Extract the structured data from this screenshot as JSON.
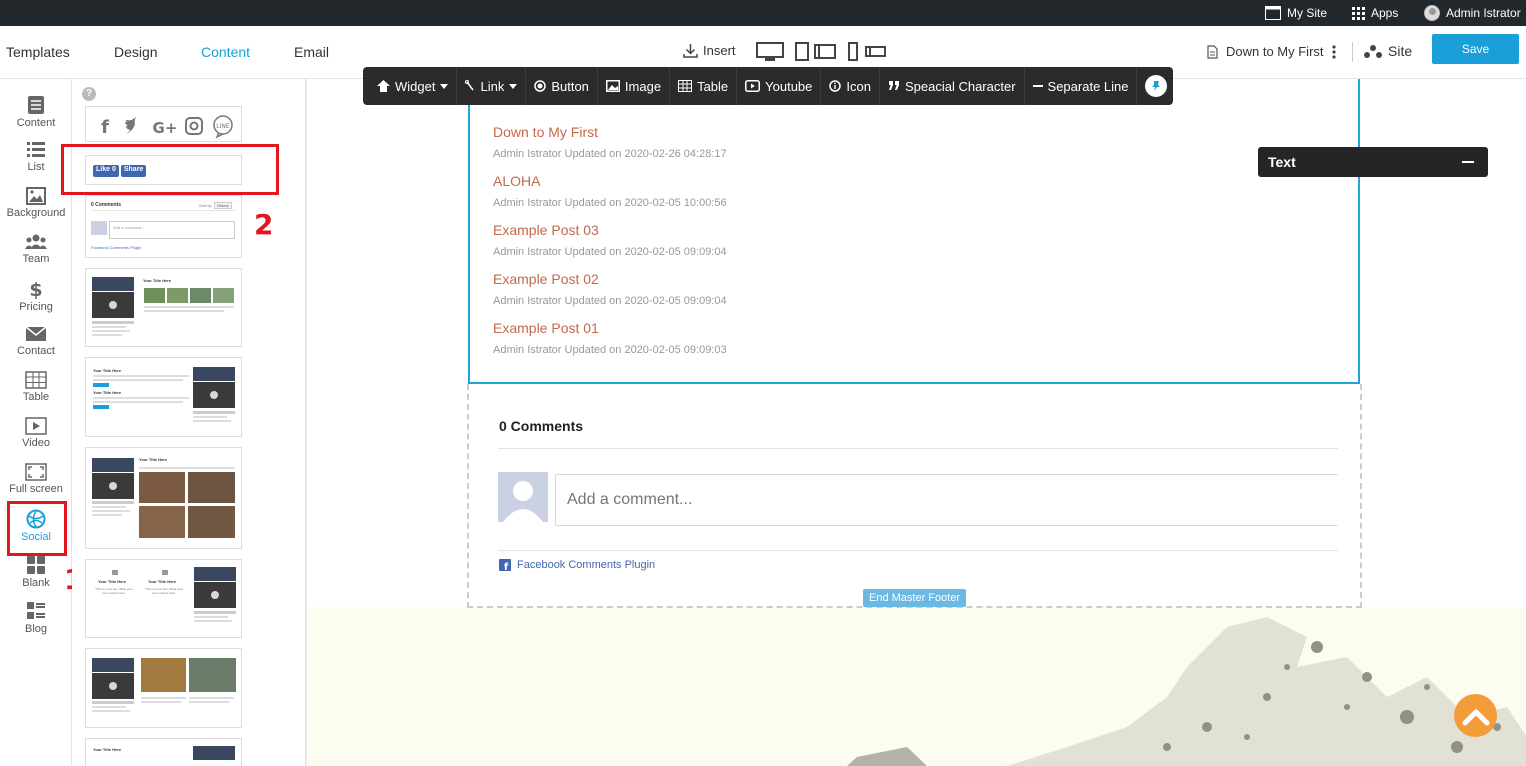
{
  "topbar": {
    "my_site": "My Site",
    "apps": "Apps",
    "user": "Admin Istrator"
  },
  "header": {
    "tabs": [
      {
        "label": "Templates"
      },
      {
        "label": "Design"
      },
      {
        "label": "Content",
        "active": true
      },
      {
        "label": "Email"
      }
    ],
    "insert": "Insert",
    "page_name": "Down to My First",
    "site": "Site",
    "save": "Save"
  },
  "sidebar": {
    "items": [
      {
        "label": "Content",
        "icon": "content-icon"
      },
      {
        "label": "List",
        "icon": "list-icon"
      },
      {
        "label": "Background",
        "icon": "image-icon"
      },
      {
        "label": "Team",
        "icon": "team-icon"
      },
      {
        "label": "Pricing",
        "icon": "dollar-icon"
      },
      {
        "label": "Contact",
        "icon": "envelope-icon"
      },
      {
        "label": "Table",
        "icon": "table-icon"
      },
      {
        "label": "Video",
        "icon": "play-icon"
      },
      {
        "label": "Full screen",
        "icon": "fullscreen-icon"
      },
      {
        "label": "Social",
        "icon": "globe-icon",
        "active": true
      },
      {
        "label": "Blank",
        "icon": "grid-icon"
      },
      {
        "label": "Blog",
        "icon": "blog-icon"
      }
    ]
  },
  "annotations": {
    "marker_1": "1",
    "marker_2": "2"
  },
  "blocks": {
    "like_label": "Like 0",
    "share_label": "Share",
    "comments_title": "0 Comments",
    "sort_by": "Sort by",
    "sort_value": "Oldest",
    "add_comment": "Add a comment...",
    "plugin": "Facebook Comments Plugin",
    "your_title": "Your Title Here",
    "text_box": "This is a text box. Write your own content here."
  },
  "toolbar": {
    "widget": "Widget",
    "link": "Link",
    "button": "Button",
    "image": "Image",
    "table": "Table",
    "youtube": "Youtube",
    "icon": "Icon",
    "special": "Speacial Character",
    "separator": "Separate Line"
  },
  "posts": [
    {
      "title": "Down to My First",
      "meta": "Admin Istrator Updated on 2020-02-26 04:28:17"
    },
    {
      "title": "ALOHA",
      "meta": "Admin Istrator Updated on 2020-02-05 10:00:56"
    },
    {
      "title": "Example Post 03",
      "meta": "Admin Istrator Updated on 2020-02-05 09:09:04"
    },
    {
      "title": "Example Post 02",
      "meta": "Admin Istrator Updated on 2020-02-05 09:09:04"
    },
    {
      "title": "Example Post 01",
      "meta": "Admin Istrator Updated on 2020-02-05 09:09:03"
    }
  ],
  "comments": {
    "count": "0 Comments",
    "placeholder": "Add a comment...",
    "plugin": "Facebook Comments Plugin"
  },
  "footer_marker": "End Master Footer",
  "text_panel": {
    "title": "Text"
  },
  "colors": {
    "accent": "#1a9fd8",
    "highlight": "#e3161d",
    "post_title": "#c26a4a",
    "toolbar_bg": "#2b2b2b",
    "scroll_top": "#f39c3a"
  }
}
